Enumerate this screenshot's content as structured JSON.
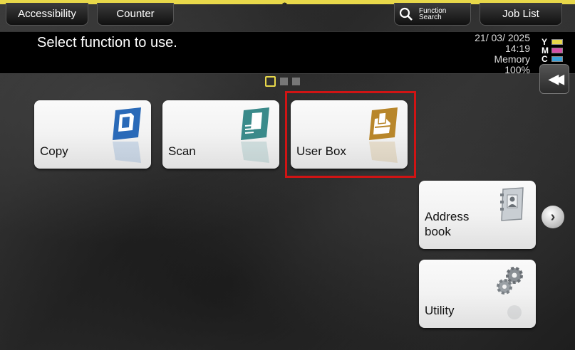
{
  "top_buttons": {
    "accessibility": "Accessibility",
    "counter": "Counter",
    "function_search_line1": "Function",
    "function_search_line2": "Search",
    "job_list": "Job List"
  },
  "header": {
    "message": "Select function to use.",
    "date": "21/ 03/ 2025",
    "time": "14:19",
    "memory_label": "Memory",
    "memory_value": "100%"
  },
  "toner": [
    {
      "letter": "Y",
      "color": "#e8d84a"
    },
    {
      "letter": "M",
      "color": "#d44fa8"
    },
    {
      "letter": "C",
      "color": "#3aa0d8"
    }
  ],
  "tiles": {
    "copy": "Copy",
    "scan": "Scan",
    "user_box": "User Box",
    "address_line1": "Address",
    "address_line2": "book",
    "utility": "Utility"
  },
  "pagination": {
    "pages": 3,
    "current": 1
  },
  "icons": {
    "copy": "copy-icon",
    "scan": "scan-icon",
    "user_box": "user-box-icon",
    "address_book": "address-book-icon",
    "utility": "gears-icon",
    "function_search": "search-icon",
    "collapse": "double-chevron-left-icon",
    "next": "chevron-right-icon"
  },
  "colors": {
    "accent_yellow": "#e8d84a",
    "highlight_red": "#d01414",
    "copy_blue": "#2a6ab8",
    "scan_teal": "#3a8a8a",
    "userbox_gold": "#b8862a"
  }
}
